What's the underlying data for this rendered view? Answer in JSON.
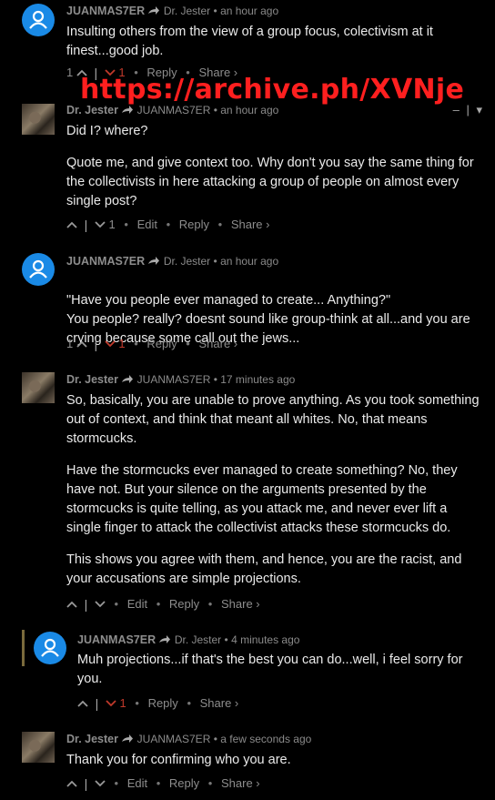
{
  "watermark": "https://archive.ph/XVNje",
  "collapse_controls": {
    "minus": "–",
    "pipe": "|",
    "caret": "▾"
  },
  "comments": [
    {
      "author": "JUANMAS7ER",
      "target": "Dr. Jester",
      "time": "• an hour ago",
      "paragraphs": [
        "Insulting others from the view of a group focus, colectivism at it finest...good job."
      ],
      "upvotes": "1",
      "downvotes": "1",
      "reply": "Reply",
      "share": "Share ›"
    },
    {
      "author": "Dr. Jester",
      "target": "JUANMAS7ER",
      "time": "• an hour ago",
      "paragraphs": [
        "Did I? where?",
        "Quote me, and give context too. Why don't you say the same thing for the collectivists in here attacking a group of people on almost every single post?"
      ],
      "downvotes": "1",
      "edit": "Edit",
      "reply": "Reply",
      "share": "Share ›"
    },
    {
      "author": "JUANMAS7ER",
      "target": "Dr. Jester",
      "time": "• an hour ago",
      "paragraphs": [
        "\"Have you people ever managed to create... Anything?\"\nYou people? really? doesnt sound like group-think at all...and you are crying because some call out the jews..."
      ],
      "upvotes": "1",
      "downvotes": "1",
      "reply": "Reply",
      "share": "Share ›"
    },
    {
      "author": "Dr. Jester",
      "target": "JUANMAS7ER",
      "time": "• 17 minutes ago",
      "paragraphs": [
        "So, basically, you are unable to prove anything. As you took something out of context, and think that meant all whites. No, that means stormcucks.",
        "Have the stormcucks ever managed to create something? No, they have not. But your silence on the arguments presented by the stormcucks is quite telling, as you attack me, and never ever lift a single finger to attack the collectivist attacks these stormcucks do.",
        "This shows you agree with them, and hence, you are the racist, and your accusations are simple projections."
      ],
      "edit": "Edit",
      "reply": "Reply",
      "share": "Share ›"
    },
    {
      "author": "JUANMAS7ER",
      "target": "Dr. Jester",
      "time": "• 4 minutes ago",
      "paragraphs": [
        "Muh projections...if that's the best you can do...well, i feel sorry for you."
      ],
      "downvotes": "1",
      "reply": "Reply",
      "share": "Share ›"
    },
    {
      "author": "Dr. Jester",
      "target": "JUANMAS7ER",
      "time": "• a few seconds ago",
      "paragraphs": [
        "Thank you for confirming who you are."
      ],
      "edit": "Edit",
      "reply": "Reply",
      "share": "Share ›"
    }
  ]
}
